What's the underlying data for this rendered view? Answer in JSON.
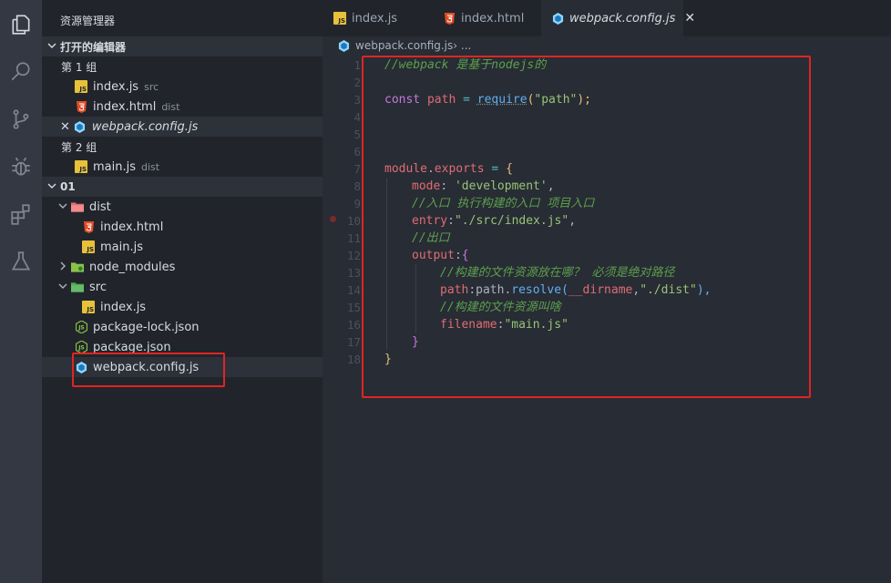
{
  "sidebar": {
    "title": "资源管理器",
    "open_editors": {
      "header": "打开的编辑器",
      "group1": "第 1 组",
      "group2": "第 2 组",
      "items_g1": [
        {
          "name": "index.js",
          "desc": "src"
        },
        {
          "name": "index.html",
          "desc": "dist"
        },
        {
          "name": "webpack.config.js",
          "desc": ""
        }
      ],
      "items_g2": [
        {
          "name": "main.js",
          "desc": "dist"
        }
      ]
    },
    "project": {
      "header": "01",
      "tree": [
        {
          "name": "dist"
        },
        {
          "name": "index.html"
        },
        {
          "name": "main.js"
        },
        {
          "name": "node_modules"
        },
        {
          "name": "src"
        },
        {
          "name": "index.js"
        },
        {
          "name": "package-lock.json"
        },
        {
          "name": "package.json"
        },
        {
          "name": "webpack.config.js"
        }
      ]
    }
  },
  "tabs": [
    {
      "label": "index.js"
    },
    {
      "label": "index.html"
    },
    {
      "label": "webpack.config.js",
      "close": "✕"
    }
  ],
  "breadcrumb": {
    "file": "webpack.config.js",
    "sep": " › ..."
  },
  "editor": {
    "line_numbers": [
      "1",
      "2",
      "3",
      "4",
      "5",
      "6",
      "7",
      "8",
      "9",
      "10",
      "11",
      "12",
      "13",
      "14",
      "15",
      "16",
      "17",
      "18"
    ],
    "lines": {
      "l1": "//webpack 是基于nodejs的",
      "l3_const": "const",
      "l3_path": " path ",
      "l3_eq": "=",
      "l3_require": "require",
      "l3_open": "(",
      "l3_str": "\"path\"",
      "l3_close": ");",
      "l7_module": "module",
      "l7_dot": ".",
      "l7_exports": "exports",
      "l7_eq": " = ",
      "l7_brace": "{",
      "l8_key": "mode",
      "l8_colon": ": ",
      "l8_val": "'development'",
      "l8_comma": ",",
      "l9": "//入口 执行构建的入口 项目入口",
      "l10_key": "entry",
      "l10_colon": ":",
      "l10_val": "\"./src/index.js\"",
      "l10_comma": ",",
      "l11": "//出口",
      "l12_key": "output",
      "l12_colon": ":",
      "l12_brace": "{",
      "l13": "//构建的文件资源放在哪？ 必须是绝对路径",
      "l14_key": "path",
      "l14_colon": ":",
      "l14_obj": "path",
      "l14_dot": ".",
      "l14_fn": "resolve",
      "l14_open": "(",
      "l14_dirname": "__dirname",
      "l14_comma": ",",
      "l14_str": "\"./dist\"",
      "l14_close": "),",
      "l15": "//构建的文件资源叫啥",
      "l16_key": "filename",
      "l16_colon": ":",
      "l16_val": "\"main.js\"",
      "l17": "}",
      "l18": "}"
    }
  },
  "colors": {
    "highlight_box": "#e02424",
    "comment": "#5ca04e",
    "keyword": "#c678dd",
    "property": "#e06c75",
    "function": "#61afef",
    "string": "#98c379"
  }
}
